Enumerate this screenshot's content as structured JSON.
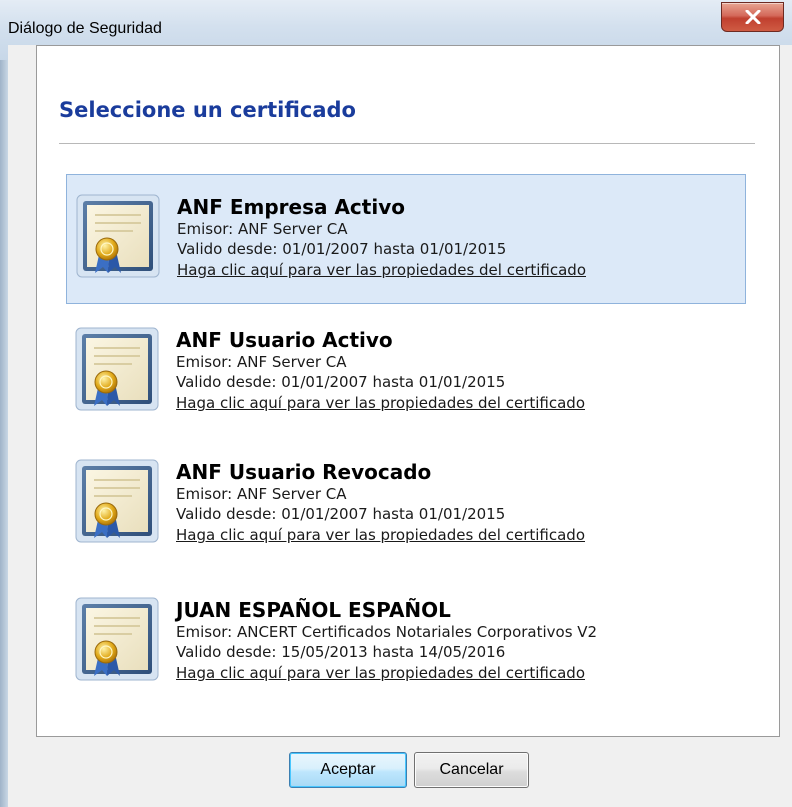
{
  "window": {
    "title": "Diálogo de Seguridad",
    "close_glyph": "close-icon"
  },
  "dialog": {
    "heading": "Seleccione un certificado",
    "certificates": [
      {
        "name": "ANF Empresa Activo",
        "issuer": "Emisor: ANF Server CA",
        "validity": "Valido desde: 01/01/2007 hasta 01/01/2015",
        "link": "Haga clic aquí para ver las propiedades del certificado",
        "icon": "certificate-icon",
        "selected": true
      },
      {
        "name": "ANF Usuario Activo",
        "issuer": "Emisor: ANF Server CA",
        "validity": "Valido desde: 01/01/2007 hasta 01/01/2015",
        "link": "Haga clic aquí para ver las propiedades del certificado",
        "icon": "certificate-icon",
        "selected": false
      },
      {
        "name": "ANF Usuario Revocado",
        "issuer": "Emisor: ANF Server CA",
        "validity": "Valido desde: 01/01/2007 hasta 01/01/2015",
        "link": "Haga clic aquí para ver las propiedades del certificado",
        "icon": "certificate-icon",
        "selected": false
      },
      {
        "name": "JUAN ESPAÑOL ESPAÑOL",
        "issuer": "Emisor: ANCERT Certificados Notariales Corporativos V2",
        "validity": "Valido desde: 15/05/2013 hasta 14/05/2016",
        "link": "Haga clic aquí para ver las propiedades del certificado",
        "icon": "certificate-icon",
        "selected": false
      }
    ]
  },
  "buttons": {
    "accept_label": "Aceptar",
    "cancel_label": "Cancelar"
  },
  "colors": {
    "heading": "#1a3c9c",
    "selected_bg": "#dce9f8",
    "selected_border": "#8fb3dc"
  }
}
